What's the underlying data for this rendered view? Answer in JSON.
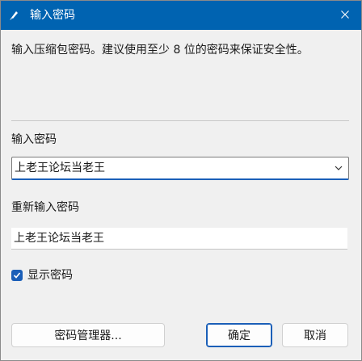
{
  "window": {
    "title": "输入密码",
    "app_icon": "pin-icon",
    "close_icon": "close-icon",
    "accent_color": "#1b5fb8"
  },
  "description": "输入压缩包密码。建议使用至少 8 位的密码来保证安全性。",
  "password": {
    "label": "输入密码",
    "value": "上老王论坛当老王",
    "dropdown_icon": "chevron-down-icon"
  },
  "confirm_password": {
    "label": "重新输入密码",
    "value": "上老王论坛当老王"
  },
  "show_password": {
    "label": "显示密码",
    "checked": true
  },
  "buttons": {
    "manager": "密码管理器...",
    "ok": "确定",
    "cancel": "取消"
  }
}
